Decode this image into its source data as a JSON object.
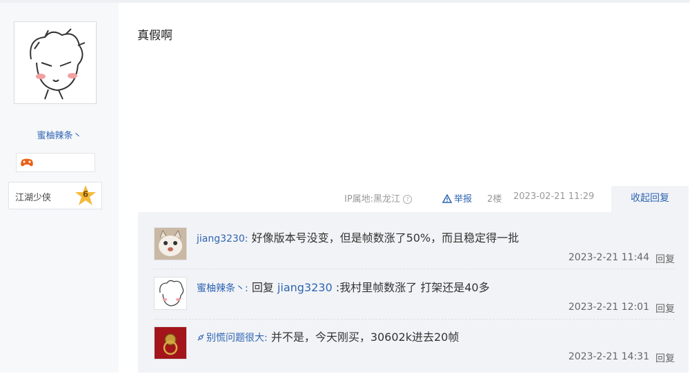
{
  "author": {
    "username": "蜜柚辣条丶",
    "rank_title": "江湖少侠",
    "level": "6"
  },
  "post": {
    "content": "真假啊",
    "ip_location": "IP属地:黑龙江",
    "report_label": "举报",
    "floor": "2楼",
    "date": "2023-02-21 11:29",
    "collapse_label": "收起回复"
  },
  "replies": [
    {
      "user": "jiang3230:",
      "prefix": "",
      "target": "",
      "text": "好像版本号没变，但是帧数涨了50%，而且稳定得一批",
      "time": "2023-2-21 11:44",
      "reply_label": "回复"
    },
    {
      "user": "蜜柚辣条丶:",
      "prefix": "回复",
      "target": "jiang3230",
      "text": ":我村里帧数涨了 打架还是40多",
      "time": "2023-2-21 12:01",
      "reply_label": "回复"
    },
    {
      "user": "别慌问题很大:",
      "prefix": "",
      "target": "",
      "text": "并不是，今天刚买，30602k进去20帧",
      "time": "2023-2-21 14:31",
      "reply_label": "回复"
    }
  ],
  "icons": {
    "report": "warning-triangle-icon",
    "ip_help": "question-circle-icon",
    "badge": "gamepad-icon",
    "level": "star-badge-icon",
    "user_prefix": "chain-link-icon"
  },
  "colors": {
    "link": "#2d64b3",
    "panel": "#f2f3f6",
    "sidebar": "#f7f8fa",
    "level_star": "#f5b93a"
  }
}
